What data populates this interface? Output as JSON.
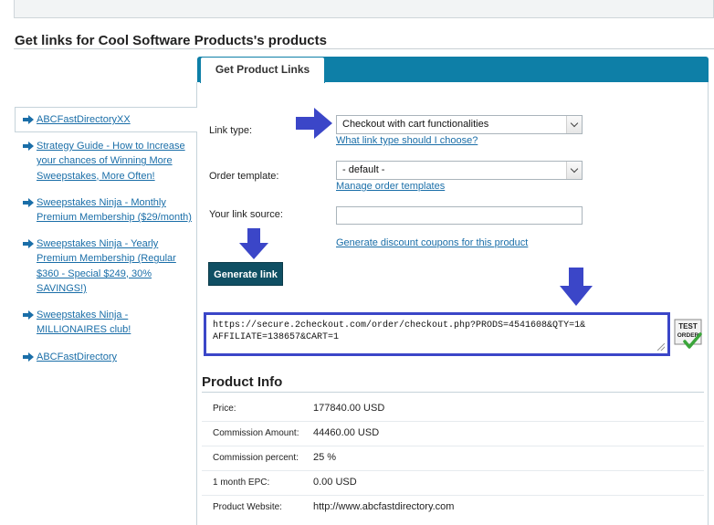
{
  "page": {
    "title": "Get links for Cool Software Products's products"
  },
  "tabs": {
    "active_label": "Get Product Links"
  },
  "sidebar": {
    "items": [
      {
        "label": "ABCFastDirectoryXX",
        "selected": true
      },
      {
        "label": "Strategy Guide - How to Increase your chances of Winning More Sweepstakes, More Often!"
      },
      {
        "label": "Sweepstakes Ninja - Monthly Premium Membership ($29/month)"
      },
      {
        "label": "Sweepstakes Ninja - Yearly Premium Membership (Regular $360 - Special $249, 30% SAVINGS!)"
      },
      {
        "label": "Sweepstakes Ninja - MILLIONAIRES club!"
      },
      {
        "label": "ABCFastDirectory"
      }
    ]
  },
  "form": {
    "link_type_label": "Link type:",
    "link_type_value": "Checkout with cart functionalities",
    "link_type_help": "What link type should I choose?",
    "order_template_label": "Order template:",
    "order_template_value": "- default -",
    "order_template_manage": "Manage order templates",
    "link_source_label": "Your link source:",
    "link_source_value": "",
    "coupons_link": "Generate discount coupons for this product",
    "generate_button": "Generate link",
    "generated_link_line1": "https://secure.2checkout.com/order/checkout.php?PRODS=4541608&QTY=1&",
    "generated_link_line2": "AFFILIATE=138657&CART=1",
    "test_order_label": "TEST ORDER"
  },
  "product_info": {
    "title": "Product Info",
    "rows": [
      {
        "key": "Price:",
        "value": "177840.00 USD"
      },
      {
        "key": "Commission Amount:",
        "value": "44460.00 USD"
      },
      {
        "key": "Commission percent:",
        "value": "25 %"
      },
      {
        "key": "1 month EPC:",
        "value": "0.00 USD"
      },
      {
        "key": "Product Website:",
        "value": "http://www.abcfastdirectory.com"
      }
    ]
  },
  "colors": {
    "tab_bar": "#0e7fa7",
    "button": "#0f4f63",
    "annotation_arrow": "#3b46c8",
    "link": "#1a6ea8"
  }
}
